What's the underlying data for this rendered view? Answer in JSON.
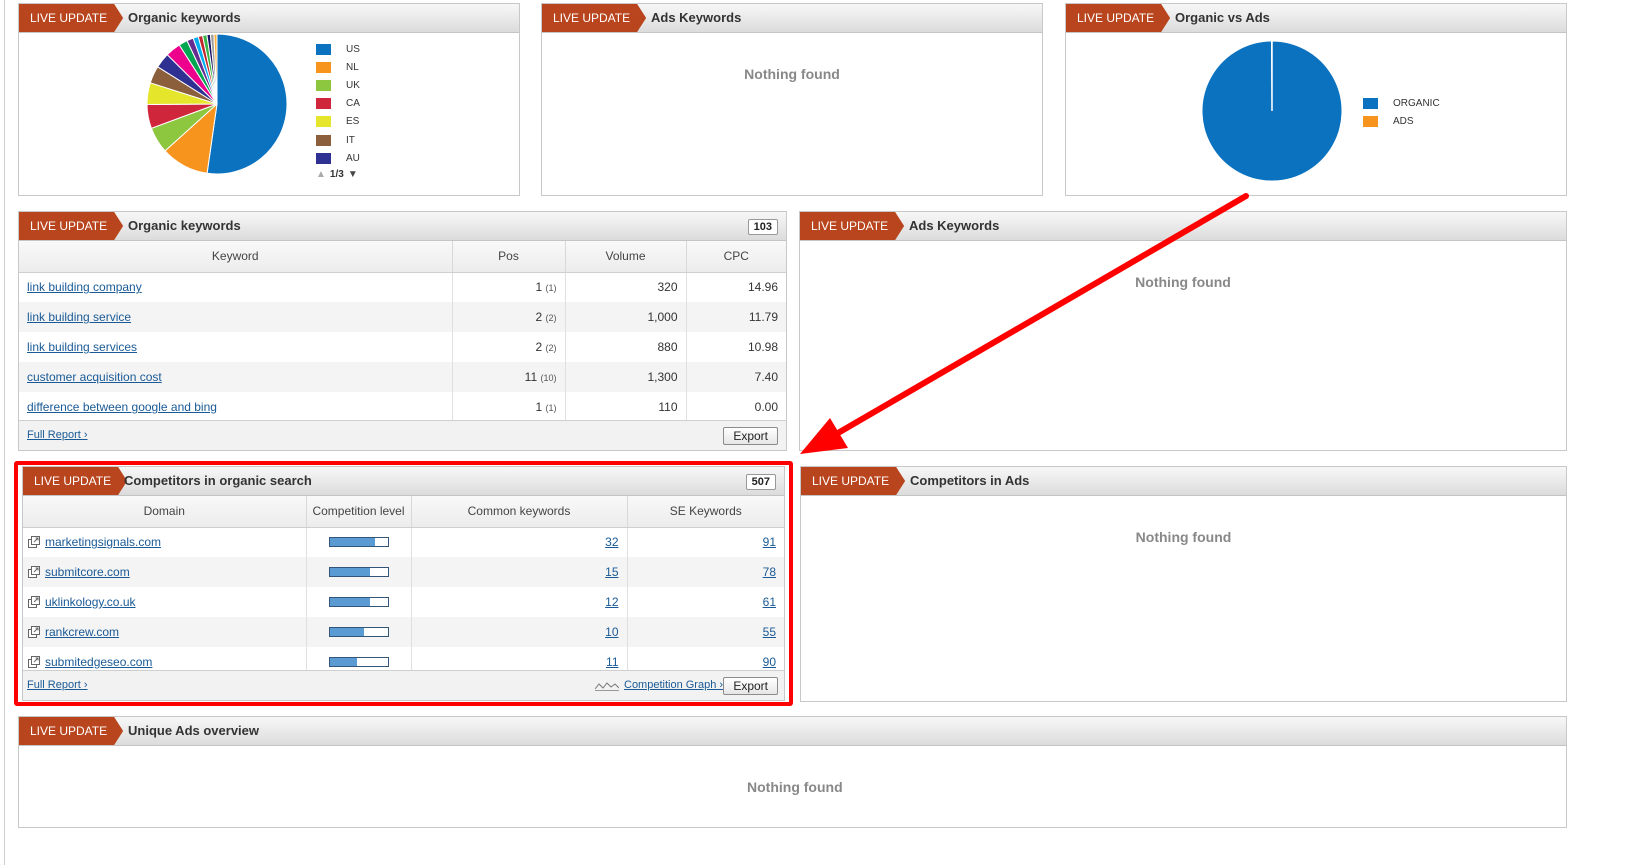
{
  "live_label": "LIVE UPDATE",
  "empty_text": "Nothing found",
  "footer": {
    "full_report": "Full Report ›",
    "export": "Export",
    "competition_graph": "Competition Graph ›"
  },
  "organic_pie": {
    "title": "Organic keywords",
    "legend": [
      {
        "label": "US",
        "color": "#0b72bf"
      },
      {
        "label": "NL",
        "color": "#f7941e"
      },
      {
        "label": "UK",
        "color": "#8dc63f"
      },
      {
        "label": "CA",
        "color": "#d0263c"
      },
      {
        "label": "ES",
        "color": "#e5e52c"
      },
      {
        "label": "IT",
        "color": "#8b5e3c"
      },
      {
        "label": "AU",
        "color": "#2e3192"
      }
    ],
    "pager": "1/3",
    "chart_data": {
      "type": "pie",
      "slices": [
        {
          "label": "US",
          "value": 52,
          "color": "#0b72bf"
        },
        {
          "label": "NL",
          "value": 11,
          "color": "#f7941e"
        },
        {
          "label": "UK",
          "value": 6,
          "color": "#8dc63f"
        },
        {
          "label": "CA",
          "value": 5.5,
          "color": "#d0263c"
        },
        {
          "label": "ES",
          "value": 5,
          "color": "#e5e52c"
        },
        {
          "label": "IT",
          "value": 4,
          "color": "#8b5e3c"
        },
        {
          "label": "AU",
          "value": 3.5,
          "color": "#2e3192"
        },
        {
          "label": "",
          "value": 3.5,
          "color": "#ec008c"
        },
        {
          "label": "",
          "value": 2,
          "color": "#00a651"
        },
        {
          "label": "",
          "value": 1.5,
          "color": "#662d91"
        },
        {
          "label": "",
          "value": 1.2,
          "color": "#00aeef"
        },
        {
          "label": "",
          "value": 1,
          "color": "#c1272d"
        },
        {
          "label": "",
          "value": 1,
          "color": "#39b54a"
        },
        {
          "label": "",
          "value": 0.8,
          "color": "#1b1464"
        },
        {
          "label": "",
          "value": 0.8,
          "color": "#9e9e9e"
        },
        {
          "label": "",
          "value": 0.7,
          "color": "#fbb040"
        }
      ]
    }
  },
  "ads_top": {
    "title": "Ads Keywords"
  },
  "org_vs_ads": {
    "title": "Organic vs Ads",
    "legend": [
      {
        "label": "ORGANIC",
        "color": "#0b72bf"
      },
      {
        "label": "ADS",
        "color": "#f7941e"
      }
    ],
    "chart_data": {
      "type": "pie",
      "slices": [
        {
          "label": "ORGANIC",
          "value": 99.9,
          "color": "#0b72bf"
        },
        {
          "label": "ADS",
          "value": 0.1,
          "color": "#f7941e"
        }
      ]
    }
  },
  "organic_table": {
    "title": "Organic keywords",
    "count": "103",
    "headers": [
      "Keyword",
      "Pos",
      "Volume",
      "CPC"
    ],
    "rows": [
      {
        "keyword": "link building company",
        "pos": "1",
        "prev": "(1)",
        "volume": "320",
        "cpc": "14.96"
      },
      {
        "keyword": "link building service",
        "pos": "2",
        "prev": "(2)",
        "volume": "1,000",
        "cpc": "11.79"
      },
      {
        "keyword": "link building services",
        "pos": "2",
        "prev": "(2)",
        "volume": "880",
        "cpc": "10.98"
      },
      {
        "keyword": "customer acquisition cost",
        "pos": "11",
        "prev": "(10)",
        "volume": "1,300",
        "cpc": "7.40"
      },
      {
        "keyword": "difference between google and bing",
        "pos": "1",
        "prev": "(1)",
        "volume": "110",
        "cpc": "0.00"
      }
    ]
  },
  "ads_mid": {
    "title": "Ads Keywords"
  },
  "competitors": {
    "title": "Competitors in organic search",
    "count": "507",
    "headers": [
      "Domain",
      "Competition level",
      "Common keywords",
      "SE Keywords"
    ],
    "rows": [
      {
        "domain": "marketingsignals.com",
        "level": 0.78,
        "common": "32",
        "se": "91"
      },
      {
        "domain": "submitcore.com",
        "level": 0.7,
        "common": "15",
        "se": "78"
      },
      {
        "domain": "uklinkology.co.uk",
        "level": 0.7,
        "common": "12",
        "se": "61"
      },
      {
        "domain": "rankcrew.com",
        "level": 0.6,
        "common": "10",
        "se": "55"
      },
      {
        "domain": "submitedgeseo.com",
        "level": 0.48,
        "common": "11",
        "se": "90"
      }
    ]
  },
  "comp_ads": {
    "title": "Competitors in Ads"
  },
  "unique_ads": {
    "title": "Unique Ads overview"
  }
}
